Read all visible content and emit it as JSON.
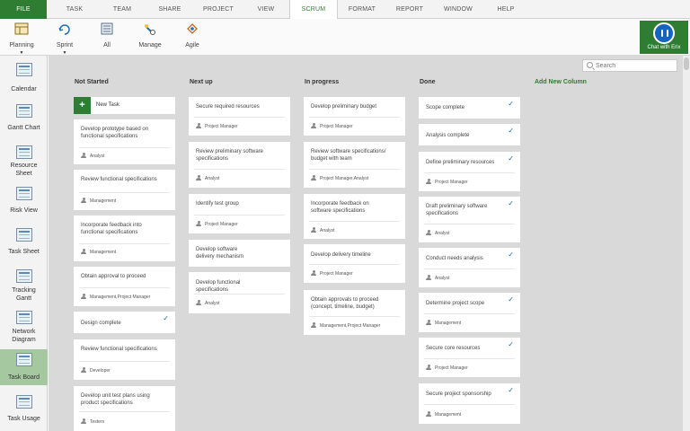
{
  "ribbon_tabs": [
    "FILE",
    "TASK",
    "TEAM",
    "SHARE",
    "PROJECT",
    "VIEW",
    "SCRUM",
    "FORMAT",
    "REPORT",
    "WINDOW",
    "HELP"
  ],
  "active_tab": "SCRUM",
  "toolbar": {
    "planning": "Planning",
    "sprint": "Sprint",
    "all": "All",
    "manage": "Manage",
    "agile": "Agile"
  },
  "chat": {
    "label": "Chat with Erix"
  },
  "views": [
    "Calendar",
    "Gantt Chart",
    "Resource Sheet",
    "Risk View",
    "Task Sheet",
    "Tracking Gantt",
    "Network Diagram",
    "Task Board",
    "Task Usage"
  ],
  "active_view": "Task Board",
  "search": {
    "placeholder": "Search"
  },
  "board": {
    "add_column": "Add New Column",
    "new_task": "New Task",
    "columns": [
      {
        "title": "Not Started",
        "cards": [
          {
            "title": "Develop prototype based on functional specifications",
            "assignee": "Analyst"
          },
          {
            "title": "Review functional specifications",
            "assignee": "Management"
          },
          {
            "title": "Incorporate feedback into functional specifications",
            "assignee": "Management"
          },
          {
            "title": "Obtain approval to proceed",
            "assignee": "Management,Project Manager"
          },
          {
            "title": "Design complete",
            "assignee": "",
            "done": true
          },
          {
            "title": "Review functional specifications",
            "assignee": "Developer"
          },
          {
            "title": "Develop unit test plans using product specifications",
            "assignee": "Testers"
          }
        ]
      },
      {
        "title": "Next up",
        "cards": [
          {
            "title": "Secure required resources",
            "assignee": "Project Manager"
          },
          {
            "title": "Review preliminary software specifications",
            "assignee": "Analyst"
          },
          {
            "title": "Identify test group",
            "assignee": "Project Manager"
          },
          {
            "title": "Develop software delivery mechanism",
            "assignee": ""
          },
          {
            "title": "Develop functional specifications",
            "assignee": "Analyst"
          }
        ]
      },
      {
        "title": "In progress",
        "cards": [
          {
            "title": "Develop preliminary budget",
            "assignee": "Project Manager"
          },
          {
            "title": "Review software specifications/ budget with team",
            "assignee": "Project Manager,Analyst"
          },
          {
            "title": "Incorporate feedback on software specifications",
            "assignee": "Analyst"
          },
          {
            "title": "Develop delivery timeline",
            "assignee": "Project Manager"
          },
          {
            "title": "Obtain approvals to proceed (concept, timeline, budget)",
            "assignee": "Management,Project Manager"
          }
        ]
      },
      {
        "title": "Done",
        "cards": [
          {
            "title": "Scope complete",
            "assignee": "",
            "done": true
          },
          {
            "title": "Analysis complete",
            "assignee": "",
            "done": true
          },
          {
            "title": "Define preliminary resources",
            "assignee": "Project Manager",
            "done": true
          },
          {
            "title": "Draft preliminary software specifications",
            "assignee": "Analyst",
            "done": true
          },
          {
            "title": "Conduct needs analysis",
            "assignee": "Analyst",
            "done": true
          },
          {
            "title": "Determine project scope",
            "assignee": "Management",
            "done": true
          },
          {
            "title": "Secure core resources",
            "assignee": "Project Manager",
            "done": true
          },
          {
            "title": "Secure project sponsorship",
            "assignee": "Management",
            "done": true
          }
        ]
      }
    ]
  },
  "colors": {
    "accent": "#2e7d32",
    "check": "#1565c0",
    "board_bg": "#d9d9d9"
  }
}
